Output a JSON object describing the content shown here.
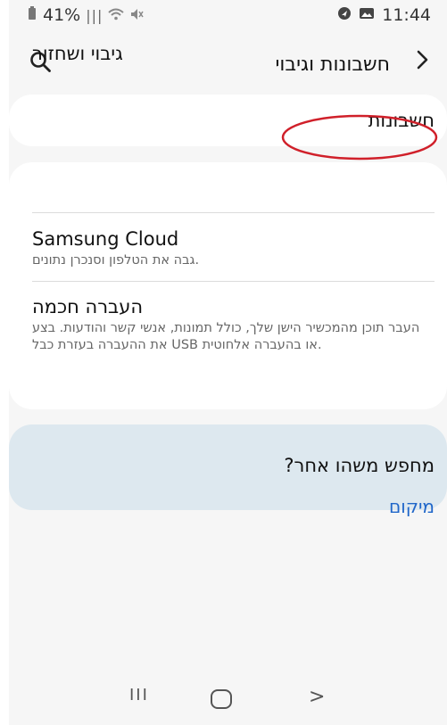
{
  "status_bar": {
    "battery": "41%",
    "time": "11:44"
  },
  "header": {
    "title": "חשבונות וגיבוי",
    "back_icon": "chevron-right-icon",
    "search_icon": "search-icon"
  },
  "accounts_card": {
    "label": "חשבונות"
  },
  "backup_card": {
    "rows": [
      {
        "title": "גיבוי ושחזור",
        "subtitle": ""
      },
      {
        "title": "Samsung Cloud",
        "subtitle": "גבה את הטלפון וסנכרן נתונים."
      },
      {
        "title": "העברה חכמה",
        "subtitle": "העבר תוכן מהמכשיר הישן שלך, כולל תמונות, אנשי קשר והודעות. בצע את ההעברה בעזרת כבל USB או בהעברה אלחוטית."
      }
    ]
  },
  "looking_for_card": {
    "question": "מחפש משהו אחר?",
    "link": "מיקום"
  },
  "nav_bar": {
    "recent": "III",
    "back": ">"
  },
  "colors": {
    "link": "#1f66c9",
    "highlight_ellipse": "#d0202a",
    "info_card_bg": "#dde8ef"
  }
}
